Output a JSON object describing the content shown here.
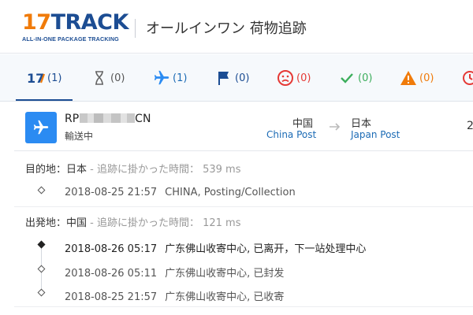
{
  "header": {
    "logo_num": "17",
    "logo_text": "TRACK",
    "logo_sub": "ALL-IN-ONE PACKAGE TRACKING",
    "title": "オールインワン 荷物追跡"
  },
  "tabs": [
    {
      "icon": "17track-logo-icon",
      "count": "(1)",
      "active": true
    },
    {
      "icon": "hourglass-icon",
      "count": "(0)"
    },
    {
      "icon": "plane-icon",
      "count": "(1)"
    },
    {
      "icon": "flag-icon",
      "count": "(0)"
    },
    {
      "icon": "sad-face-icon",
      "count": "(0)"
    },
    {
      "icon": "checkmark-icon",
      "count": "(0)"
    },
    {
      "icon": "warning-icon",
      "count": "(0)"
    }
  ],
  "package": {
    "tracking_prefix": "RP",
    "tracking_suffix": "CN",
    "status": "輸送中",
    "origin_country": "中国",
    "origin_carrier": "China Post",
    "dest_country": "日本",
    "dest_carrier": "Japan Post",
    "edge_number": "2"
  },
  "destination": {
    "label": "目的地：日本",
    "note": " - 追跡に掛かった時間： 539 ms",
    "events": [
      {
        "time": "2018-08-25 21:57",
        "desc": "CHINA, Posting/Collection"
      }
    ]
  },
  "origin": {
    "label": "出発地：中国",
    "note": " - 追跡に掛かった時間： 121 ms",
    "events": [
      {
        "time": "2018-08-26 05:17",
        "desc": "广东佛山收寄中心, 已离开，下一站处理中心"
      },
      {
        "time": "2018-08-26 05:11",
        "desc": "广东佛山收寄中心, 已封发"
      },
      {
        "time": "2018-08-25 21:57",
        "desc": "广东佛山收寄中心, 已收寄"
      }
    ]
  },
  "colors": {
    "brand_navy": "#1c4d93",
    "brand_orange": "#f07b0a",
    "plane_blue": "#2b8bf2",
    "flag_navy": "#1c4d93",
    "sad_red": "#e53935",
    "check_green": "#3cae5c",
    "warning_orange": "#f07b0a"
  }
}
